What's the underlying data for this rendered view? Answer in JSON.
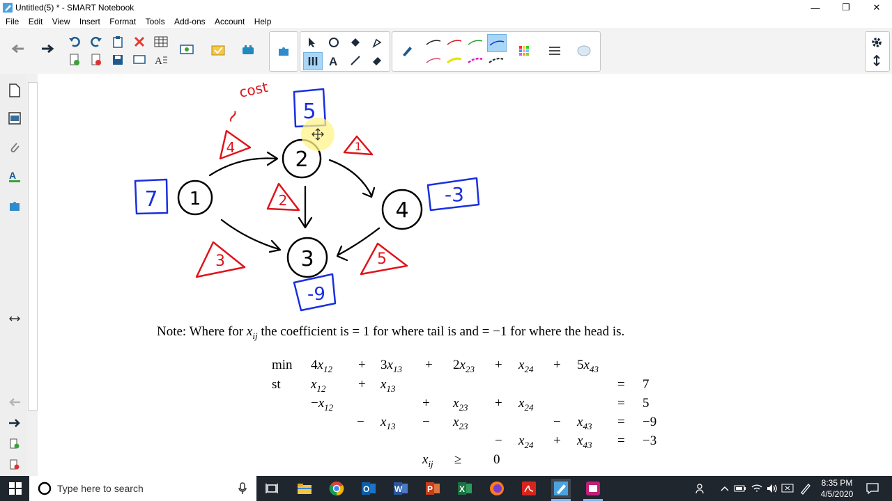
{
  "window": {
    "title": "Untitled(5) * - SMART Notebook"
  },
  "menu": [
    "File",
    "Edit",
    "View",
    "Insert",
    "Format",
    "Tools",
    "Add-ons",
    "Account",
    "Help"
  ],
  "canvas": {
    "annotations": {
      "cost_label": "cost",
      "tilde": "~"
    },
    "nodes": [
      "1",
      "2",
      "3",
      "4"
    ],
    "supplies": [
      "7",
      "5",
      "-9",
      "-3"
    ],
    "costs": [
      "4",
      "3",
      "2",
      "1",
      "5"
    ],
    "note": {
      "prefix": "Note:  Where for",
      "var": "x",
      "sub": "ij",
      "suffix": "the coefficient is = 1 for where tail is and = −1 for where the head is."
    },
    "lp": {
      "min_kw": "min",
      "st_kw": "st",
      "objective": [
        "4x12",
        "+",
        "3x13",
        "+",
        "2x23",
        "+",
        "x24",
        "+",
        "5x43"
      ],
      "rows": [
        {
          "lhs": [
            "x12",
            "+",
            "x13"
          ],
          "eq": "=",
          "rhs": "7"
        },
        {
          "lhs": [
            "−x12",
            "+",
            "x23",
            "+",
            "x24"
          ],
          "eq": "=",
          "rhs": "5"
        },
        {
          "lhs": [
            "−",
            "x13",
            "−",
            "x23",
            "−",
            "x43"
          ],
          "eq": "=",
          "rhs": "−9"
        },
        {
          "lhs": [
            "−",
            "x24",
            "+",
            "x43"
          ],
          "eq": "=",
          "rhs": "−3"
        }
      ],
      "nonneg": {
        "var": "x",
        "sub": "ij",
        "op": "≥",
        "rhs": "0"
      }
    }
  },
  "taskbar": {
    "search_placeholder": "Type here to search",
    "time": "8:35 PM",
    "date": "4/5/2020"
  },
  "colors": {
    "red_ink": "#e0141b",
    "blue_ink": "#1a2fe0",
    "taskbar": "#20262e",
    "toolbar_bg": "#f3f3f3"
  }
}
